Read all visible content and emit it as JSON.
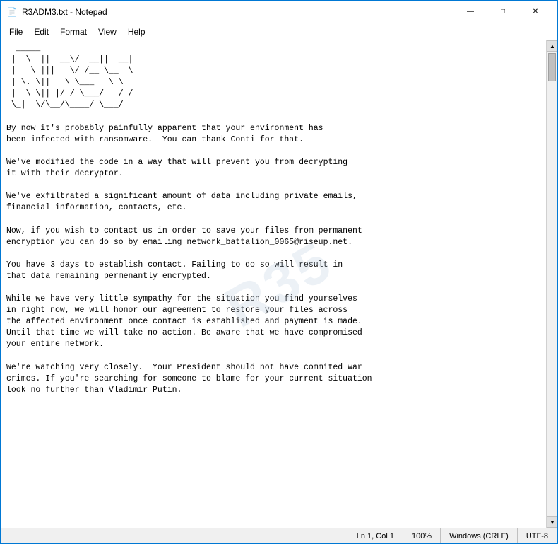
{
  "window": {
    "title": "R3ADM3.txt - Notepad",
    "icon": "📄"
  },
  "titlebar": {
    "minimize_label": "—",
    "maximize_label": "□",
    "close_label": "✕"
  },
  "menu": {
    "items": [
      "File",
      "Edit",
      "Format",
      "View",
      "Help"
    ]
  },
  "content": {
    "ascii_art": "  ____\n | \\  || __ \\/ __|| __|\n | \\ |||  \\ / /__\\_  \\\n | \\. ||  \\ \\ \\___  \\ \\\n | \\ \\|| |/ / \\___/  / /\n \\_| \\/\\__/\\____/\\___/",
    "body_text": "By now it's probably painfully apparent that your environment has\nbeen infected with ransomware.  You can thank Conti for that.\n\nWe've modified the code in a way that will prevent you from decrypting\nit with their decryptor.\n\nWe've exfiltrated a significant amount of data including private emails,\nfinancial information, contacts, etc.\n\nNow, if you wish to contact us in order to save your files from permanent\nencryption you can do so by emailing network_battalion_0065@riseup.net.\n\nYou have 3 days to establish contact. Failing to do so will result in\nthat data remaining permenantly encrypted.\n\nWhile we have very little sympathy for the situation you find yourselves\nin right now, we will honor our agreement to restore your files across\nthe affected environment once contact is established and payment is made.\nUntil that time we will take no action. Be aware that we have compromised\nyour entire network.\n\nWe're watching very closely.  Your President should not have commited war\ncrimes. If you're searching for someone to blame for your current situation\nlook no further than Vladimir Putin."
  },
  "statusbar": {
    "position": "Ln 1, Col 1",
    "zoom": "100%",
    "line_ending": "Windows (CRLF)",
    "encoding": "UTF-8"
  },
  "watermark": {
    "text": "R35"
  }
}
